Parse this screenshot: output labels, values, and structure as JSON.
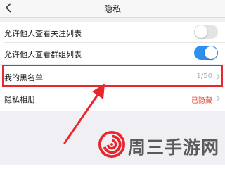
{
  "header": {
    "title": "隐私",
    "back_icon": "chevron-left-icon"
  },
  "settings": [
    {
      "label": "允许他人查看关注列表",
      "toggle": false
    },
    {
      "label": "允许他人查看群组列表",
      "toggle": true
    },
    {
      "label": "我的黑名单",
      "value": "1/50",
      "value_color": "#b0b0b0"
    },
    {
      "label": "隐私相册",
      "value": "已隐藏",
      "value_color": "#e0452d"
    }
  ],
  "watermark": {
    "text": "周三手游网",
    "logo_icon": "swirl-logo-icon",
    "accent": "#e8262c"
  },
  "colors": {
    "toggle_on": "#2e8ff0",
    "toggle_off": "#e4e4e4",
    "highlight": "#e8262c",
    "annotation_arrow": "#e8262c"
  }
}
